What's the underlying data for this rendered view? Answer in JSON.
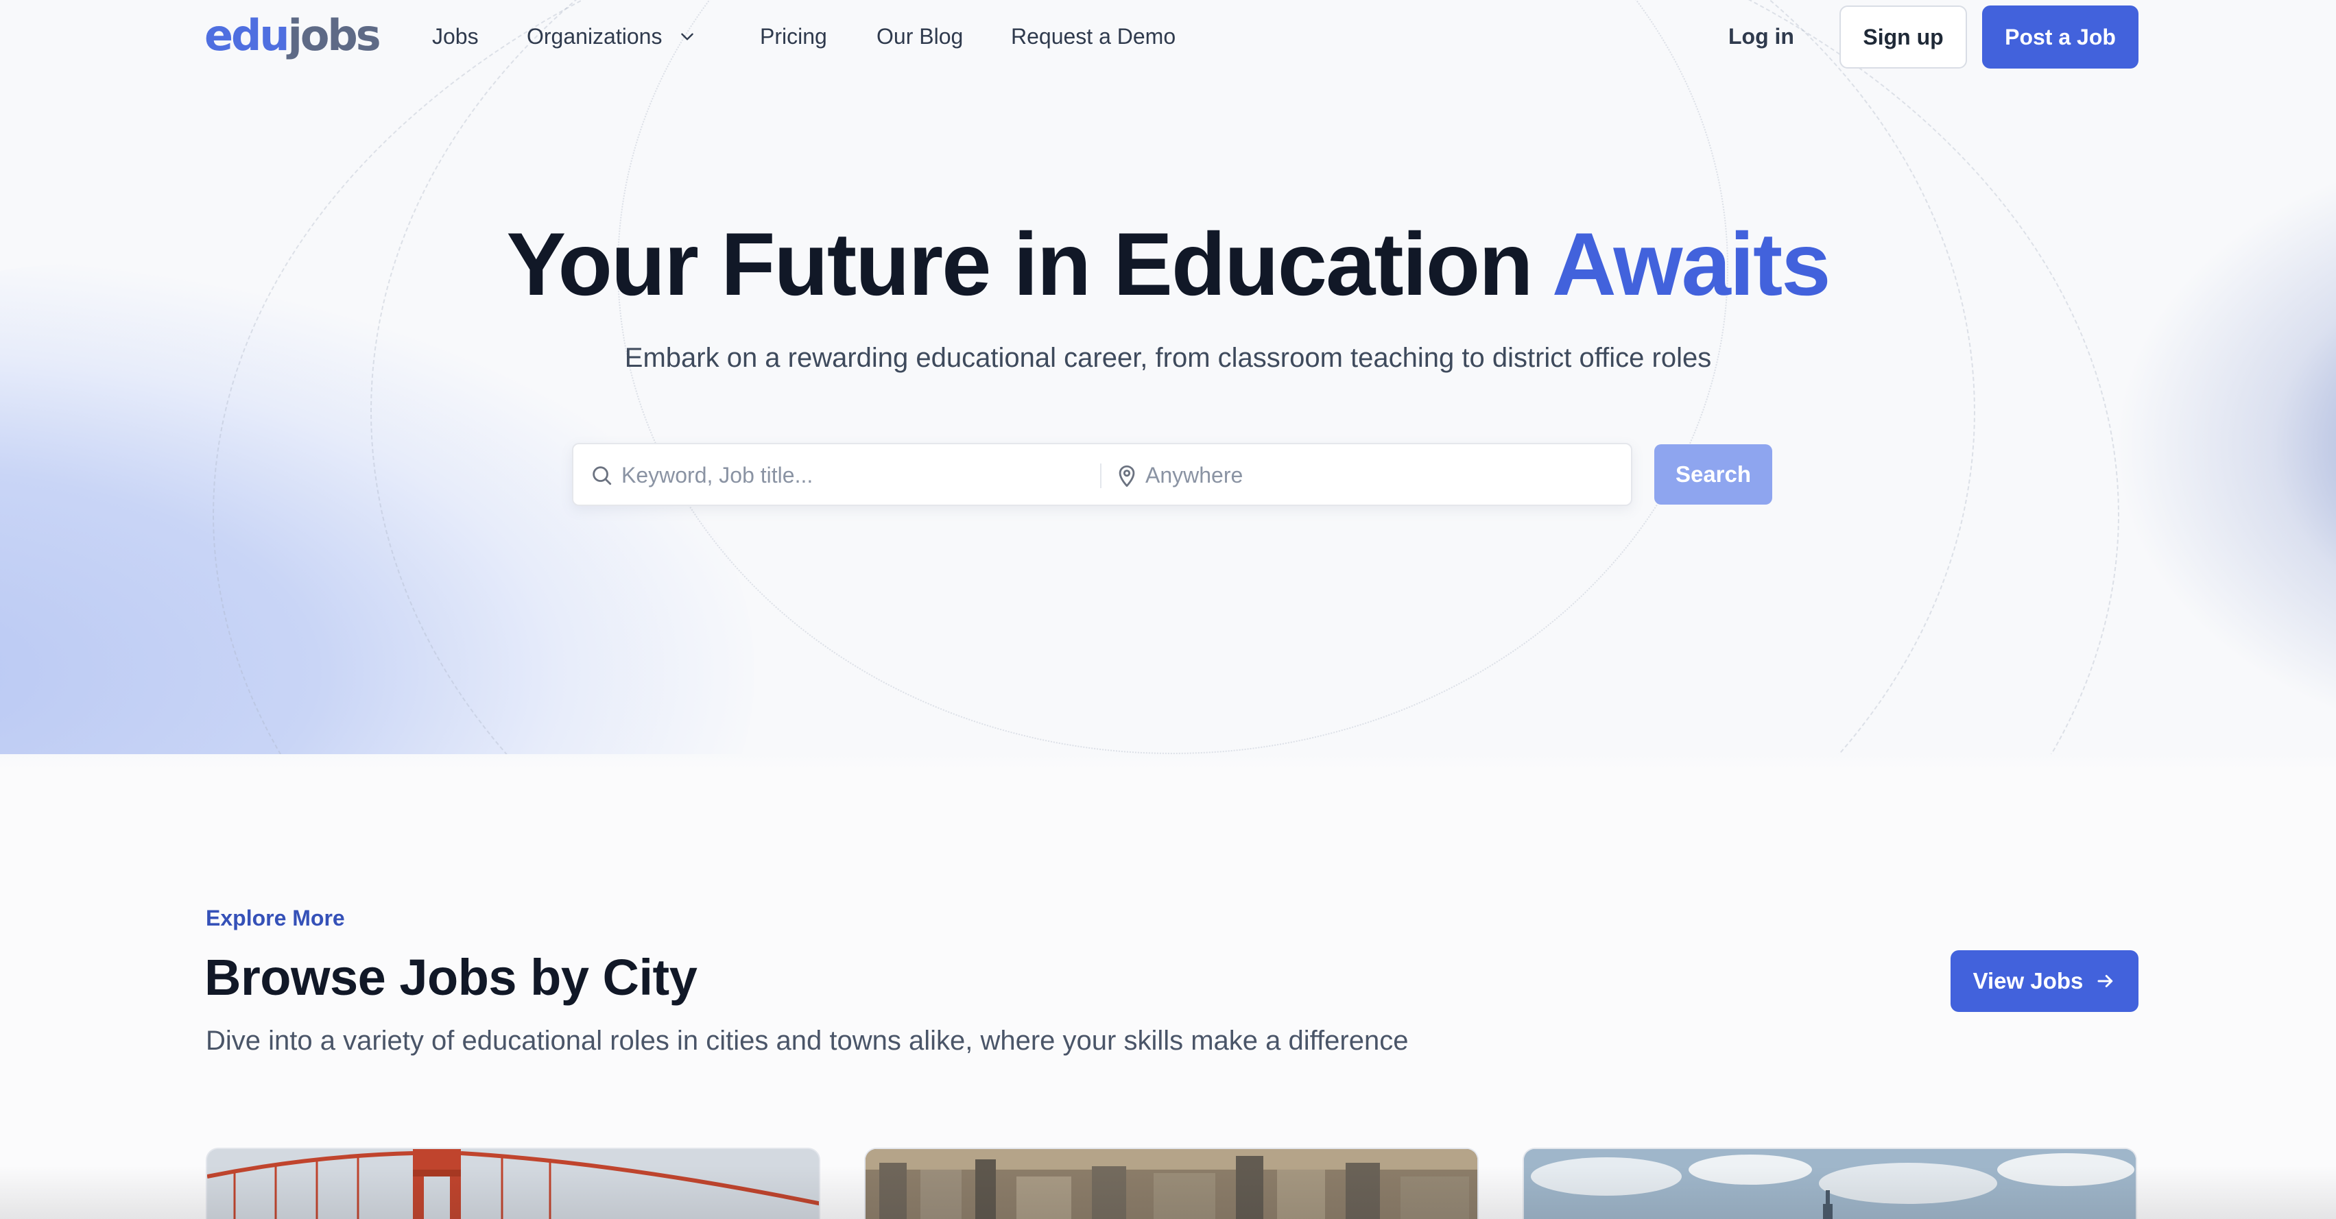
{
  "brand": {
    "logo_part1": "edu",
    "logo_part2": "jobs"
  },
  "nav": {
    "links": [
      {
        "label": "Jobs"
      },
      {
        "label": "Organizations"
      },
      {
        "label": "Pricing"
      },
      {
        "label": "Our Blog"
      },
      {
        "label": "Request a Demo"
      }
    ],
    "login_label": "Log in",
    "signup_label": "Sign up",
    "post_job_label": "Post a Job"
  },
  "hero": {
    "title_main": "Your Future in Education ",
    "title_accent": "Awaits",
    "subtitle": "Embark on a rewarding educational career, from classroom teaching to district office roles",
    "search": {
      "keyword_placeholder": "Keyword, Job title...",
      "location_placeholder": "Anywhere",
      "button_label": "Search"
    }
  },
  "browse": {
    "eyebrow": "Explore More",
    "title": "Browse Jobs by City",
    "subtitle": "Dive into a variety of educational roles in cities and towns alike, where your skills make a difference",
    "button_label": "View Jobs",
    "cities": [
      {
        "image": "bridge-city-photo"
      },
      {
        "image": "aerial-city-photo"
      },
      {
        "image": "skyline-clouds-photo"
      }
    ]
  },
  "colors": {
    "accent": "#4262dc",
    "search_button": "#8ea5ef",
    "heading": "#111827",
    "logo_edu": "#4f6fe0",
    "logo_jobs": "#5e6a86"
  },
  "icons": {
    "search": "search-icon",
    "location": "map-pin-icon",
    "dropdown": "chevron-down-icon",
    "arrow": "arrow-right-icon"
  }
}
